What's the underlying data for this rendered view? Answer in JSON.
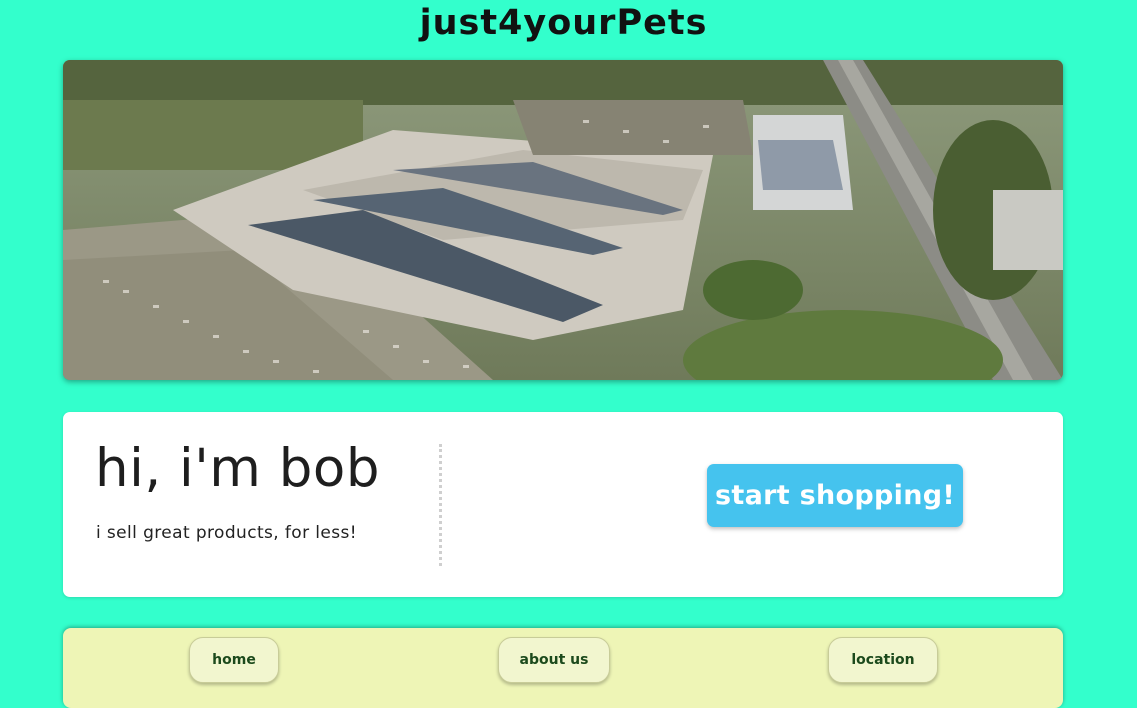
{
  "header": {
    "title": "just4yourPets"
  },
  "hero": {
    "image": "aerial-view-of-market-complex"
  },
  "intro": {
    "heading": "hi, i'm bob",
    "tagline": "i sell great products, for less!",
    "cta_label": "start shopping!"
  },
  "nav": {
    "items": [
      {
        "label": "home"
      },
      {
        "label": "about us"
      },
      {
        "label": "location"
      }
    ]
  },
  "colors": {
    "page_background": "#33ffcc",
    "cta_background": "#45c3ee",
    "nav_background": "#eef5b6",
    "nav_text": "#1c4a1c"
  }
}
